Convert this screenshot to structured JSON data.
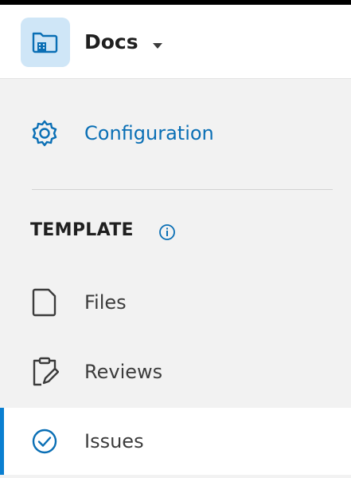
{
  "header": {
    "app_name": "Docs",
    "app_icon": "folder-building-icon",
    "dropdown_icon": "caret-down-icon"
  },
  "sidebar": {
    "config": {
      "label": "Configuration",
      "icon": "gear-icon"
    },
    "section": {
      "title": "TEMPLATE",
      "info_icon": "info-icon"
    },
    "items": [
      {
        "label": "Files",
        "icon": "file-icon"
      },
      {
        "label": "Reviews",
        "icon": "clipboard-pen-icon"
      },
      {
        "label": "Issues",
        "icon": "check-circle-icon",
        "active": true
      }
    ]
  },
  "colors": {
    "accent": "#0a6fb5",
    "active_indicator": "#0a7fd1",
    "app_icon_bg": "#cfe6f7",
    "sidebar_bg": "#f2f2f2"
  }
}
